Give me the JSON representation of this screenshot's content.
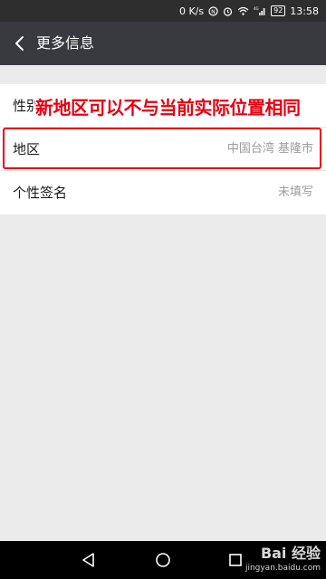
{
  "status_bar": {
    "net_speed": "0 K/s",
    "network": "4G",
    "battery": "92",
    "time": "13:58"
  },
  "header": {
    "back_icon": "chevron-left-icon",
    "title": "更多信息"
  },
  "rows": [
    {
      "label": "性别",
      "value": ""
    },
    {
      "label": "地区",
      "value": "中国台湾 基隆市"
    },
    {
      "label": "个性签名",
      "value": "未填写"
    }
  ],
  "annotation": {
    "text": "新地区可以不与当前实际位置相同",
    "color": "#e60012"
  },
  "nav_bar": {
    "icons": [
      "back-triangle-icon",
      "home-circle-icon",
      "recents-square-icon"
    ]
  },
  "watermark": {
    "logo": "Bai 经验",
    "url": "jingyan.baidu.com"
  },
  "colors": {
    "status_bar": "#2e2e2e",
    "title_bar": "#393a3f",
    "background": "#ebebeb",
    "row_bg": "#ffffff",
    "highlight": "#e60012"
  }
}
